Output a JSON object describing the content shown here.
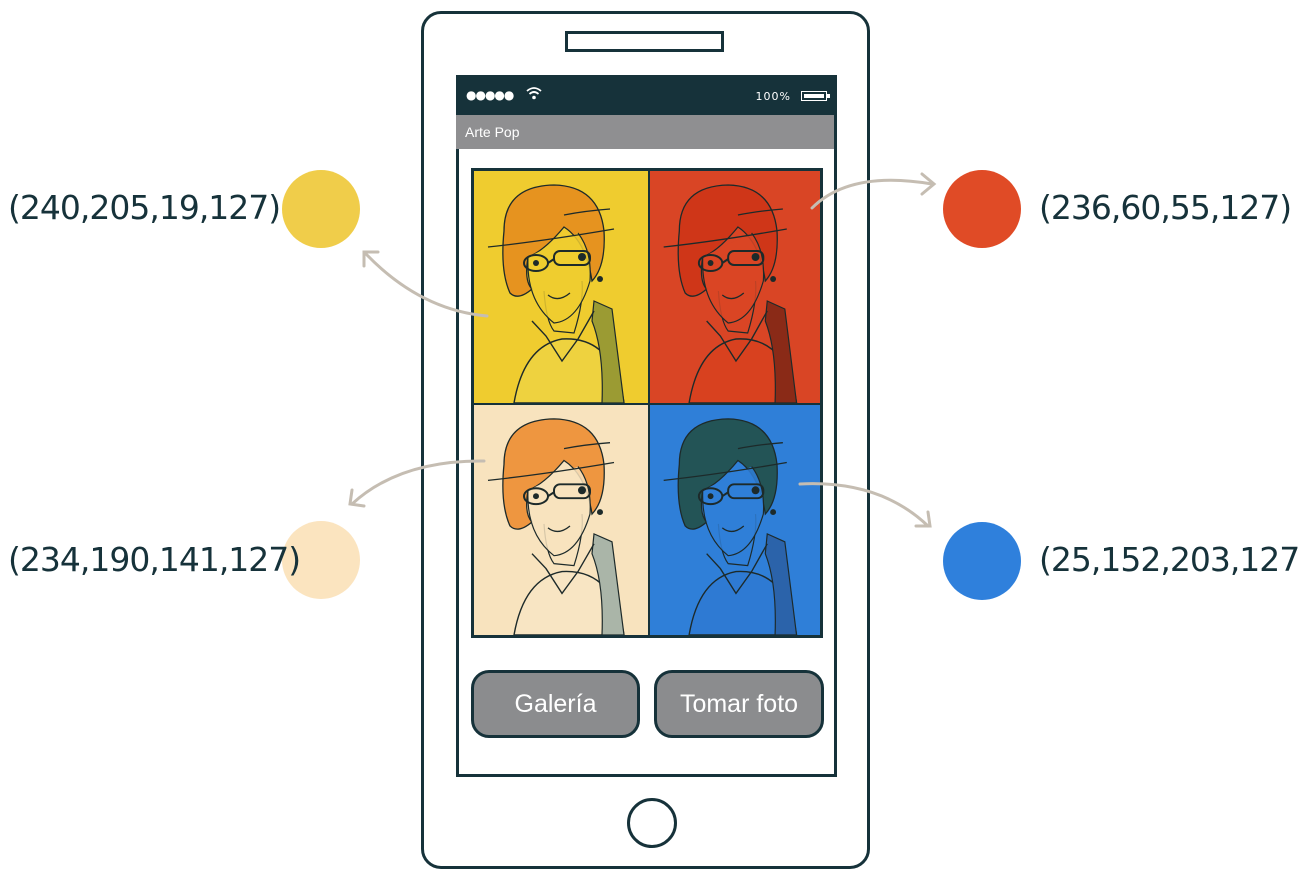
{
  "status_bar": {
    "signal_dots": "●●●●●",
    "battery_percent": "100%"
  },
  "app": {
    "title": "Arte Pop"
  },
  "buttons": {
    "gallery": "Galería",
    "take_photo": "Tomar foto"
  },
  "tiles": [
    {
      "position": "top-left",
      "background": "#efcc2f",
      "hair": "#e6931f",
      "shirt": "#eed23f",
      "accent": "#9b9b33"
    },
    {
      "position": "top-right",
      "background": "#d94525",
      "hair": "#cf3618",
      "shirt": "#d8411f",
      "accent": "#8a2a17"
    },
    {
      "position": "bottom-left",
      "background": "#f8e3be",
      "hair": "#ee9640",
      "shirt": "#f8e5c3",
      "accent": "#aab5a8"
    },
    {
      "position": "bottom-right",
      "background": "#2f7fd8",
      "hair": "#235456",
      "shirt": "#2e7ad3",
      "accent": "#2b63aa"
    }
  ],
  "swatches": [
    {
      "label": "(240,205,19,127)",
      "color": "#f0cd4a",
      "side": "left",
      "tile": "top-left"
    },
    {
      "label": "(236,60,55,127)",
      "color": "#e04b26",
      "side": "right",
      "tile": "top-right"
    },
    {
      "label": "(234,190,141,127)",
      "color": "#fbe4bf",
      "side": "left",
      "tile": "bottom-left"
    },
    {
      "label": "(25,152,203,127)",
      "color": "#2f80dc",
      "side": "right",
      "tile": "bottom-right"
    }
  ],
  "colors": {
    "outline": "#16323a",
    "header": "#8f8f91",
    "button": "#8b8c8e",
    "arrow": "#c5bdb2"
  }
}
